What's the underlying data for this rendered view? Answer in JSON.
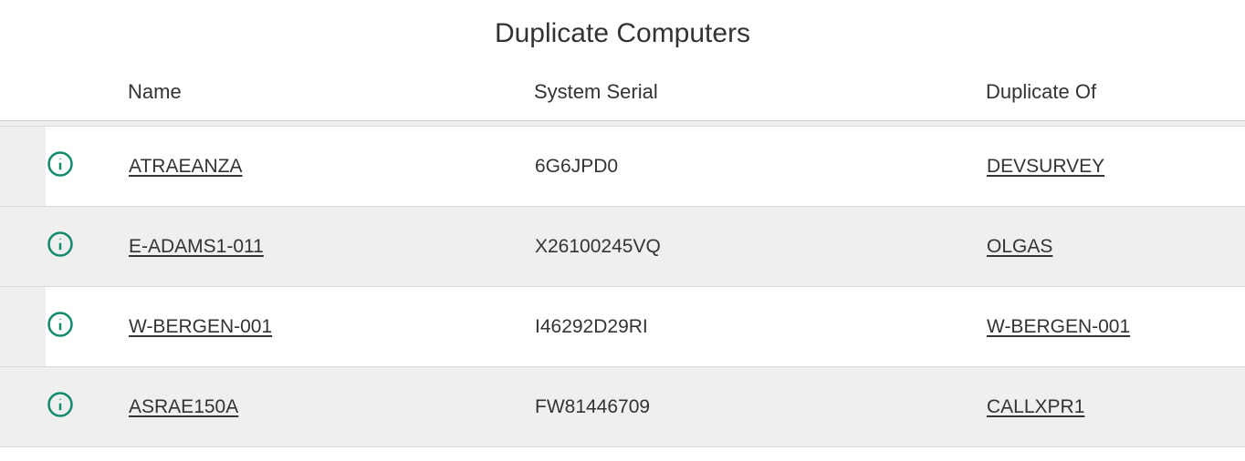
{
  "title": "Duplicate Computers",
  "columns": {
    "name": "Name",
    "serial": "System Serial",
    "duplicate_of": "Duplicate Of"
  },
  "rows": [
    {
      "name": "ATRAEANZA",
      "serial": "6G6JPD0",
      "duplicate_of": "DEVSURVEY"
    },
    {
      "name": "E-ADAMS1-011",
      "serial": "X26100245VQ",
      "duplicate_of": "OLGAS"
    },
    {
      "name": "W-BERGEN-001",
      "serial": "I46292D29RI",
      "duplicate_of": "W-BERGEN-001"
    },
    {
      "name": "ASRAE150A",
      "serial": "FW81446709",
      "duplicate_of": "CALLXPR1"
    }
  ]
}
